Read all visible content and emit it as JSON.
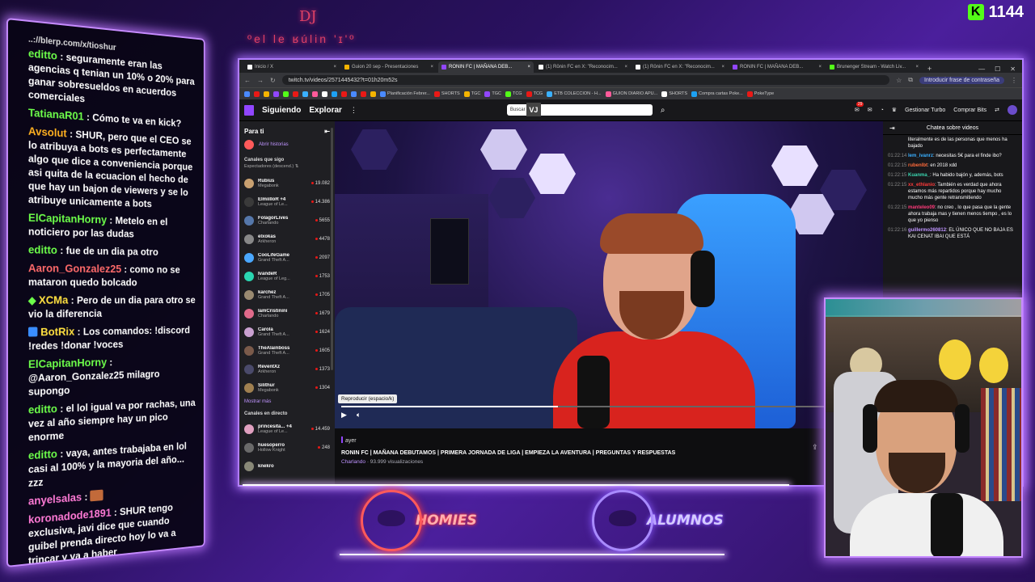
{
  "overlay": {
    "scribble_top": "DJ",
    "scribble_bottom": "ºel le ʁúlin 'ɪ'º",
    "viewer_count": "1144",
    "viewer_platform_icon": "kick-icon",
    "logo_left": "HOMIES",
    "logo_right": "ALUMNOS"
  },
  "stream_chat": [
    {
      "user": "editto",
      "color": "#6dff4a",
      "text": "seguramente eran las agencias q tenian un 10% o 20% para ganar sobresueldos en acuerdos comerciales",
      "prefix": "..://blerp.com/x/tioshur"
    },
    {
      "user": "TatianaR01",
      "color": "#6dff4a",
      "text": "Cómo te va en kick?"
    },
    {
      "user": "Avsolut",
      "color": "#ffb020",
      "text": "SHUR, pero que el CEO se lo atribuya a bots es perfectamente algo que dice a conveniencia porque asi quita de la ecuacion el hecho de que hay un bajon de viewers y se lo atribuye unicamente a bots"
    },
    {
      "user": "ElCapitanHorny",
      "color": "#6dff4a",
      "text": "Metelo en el noticiero por las dudas"
    },
    {
      "user": "editto",
      "color": "#6dff4a",
      "text": "fue de un dia pa otro"
    },
    {
      "user": "Aaron_Gonzalez25",
      "color": "#ff6a6a",
      "text": "como no se mataron quedo bolcado"
    },
    {
      "user": "XCMa",
      "color": "#ffe040",
      "text": "Pero de un dia para otro se vio la diferencia"
    },
    {
      "user": "BotRix",
      "color": "#ffe040",
      "text": "Los comandos: !discord !redes !donar !voces"
    },
    {
      "user": "ElCapitanHorny",
      "color": "#6dff4a",
      "text": "@Aaron_Gonzalez25 milagro supongo"
    },
    {
      "user": "editto",
      "color": "#6dff4a",
      "text": "el lol igual va por rachas, una vez al año siempre hay un pico enorme"
    },
    {
      "user": "editto",
      "color": "#6dff4a",
      "text": "vaya, antes trabajaba en lol casi al 100% y la mayoria del año... zzz"
    },
    {
      "user": "anyelsalas",
      "color": "#ff7ad6",
      "text": ""
    },
    {
      "user": "koronadode1891",
      "color": "#ff7ad6",
      "text": "SHUR tengo exclusiva, javi dice que cuando guibel prenda directo hoy lo va a trincar y va a haber debateeeeeeeeeeeeee"
    }
  ],
  "browser": {
    "tabs": [
      {
        "label": "Inicio / X",
        "color": "#fff"
      },
      {
        "label": "Guion 20 sep - Presentaciones",
        "color": "#f4b400"
      },
      {
        "label": "RONIN FC | MAÑANA DEB...",
        "color": "#9146ff"
      },
      {
        "label": "(1) Rōnin FC en X: \"Reconocim...",
        "color": "#fff"
      },
      {
        "label": "(1) Rōnin FC en X: \"Reconocim...",
        "color": "#fff"
      },
      {
        "label": "RONIN FC | MAÑANA DEB...",
        "color": "#9146ff"
      },
      {
        "label": "Brunenger Stream - Watch Liv...",
        "color": "#53fc18"
      }
    ],
    "new_tab": "+",
    "url": "twitch.tv/videos/2571445432?t=01h20m52s",
    "password_prompt": "Introducir frase de contraseña",
    "bookmarks": [
      "Planificación Febrer...",
      "SHORTS",
      "TGC",
      "TGC",
      "TCG",
      "TCG",
      "ETB COLECCION - H...",
      "GUION DIARIO APU...",
      "SHORTS",
      "Compra cartas Poke...",
      "PokeType"
    ]
  },
  "twitch": {
    "nav_following": "Siguiendo",
    "nav_browse": "Explorar",
    "search_placeholder": "Buscar",
    "search_overlay": "VJ",
    "notif_count": "29",
    "turbo": "Gestionar Turbo",
    "bits": "Comprar Bits",
    "sidebar_title": "Para ti",
    "history": "Abrir historias",
    "followed_header": "Canales que sigo",
    "followed_sub": "Espectadores (descend.)",
    "channels": [
      {
        "name": "Rubius",
        "game": "Megabonk",
        "viewers": "19.082",
        "color": "#c8a070"
      },
      {
        "name": "ElmiilloR +4",
        "game": "League of Le...",
        "viewers": "14.386",
        "color": "#3a3a3a"
      },
      {
        "name": "FolagorLives",
        "game": "Charlando",
        "viewers": "5655",
        "color": "#5577aa"
      },
      {
        "name": "elxokas",
        "game": "Arkheron",
        "viewers": "4478",
        "color": "#888"
      },
      {
        "name": "CooLifeGame",
        "game": "Grand Theft A...",
        "viewers": "2097",
        "color": "#4aa8ff"
      },
      {
        "name": "IvandeR",
        "game": "League of Leg...",
        "viewers": "1753",
        "color": "#2ad6b0"
      },
      {
        "name": "karchez",
        "game": "Grand Theft A...",
        "viewers": "1705",
        "color": "#9a8a70"
      },
      {
        "name": "IamCristinini",
        "game": "Charlando",
        "viewers": "1679",
        "color": "#e06a8a"
      },
      {
        "name": "Carola",
        "game": "Grand Theft A...",
        "viewers": "1624",
        "color": "#c9a0d0"
      },
      {
        "name": "TheAlainboss",
        "game": "Grand Theft A...",
        "viewers": "1605",
        "color": "#7a5a4a"
      },
      {
        "name": "ReventXz",
        "game": "Arkheron",
        "viewers": "1373",
        "color": "#4a4a6a"
      },
      {
        "name": "Silithur",
        "game": "Megabonk",
        "viewers": "1304",
        "color": "#a08050"
      }
    ],
    "show_more": "Mostrar más",
    "live_header": "Canales en directo",
    "live_channels": [
      {
        "name": "princesita... +4",
        "game": "League of Le...",
        "viewers": "14.459",
        "color": "#e0a0c0"
      },
      {
        "name": "huesoperro",
        "game": "Hollow Knight",
        "viewers": "248",
        "color": "#6a6a6a"
      },
      {
        "name": "knekro",
        "game": "",
        "viewers": "",
        "color": "#887"
      }
    ],
    "tooltip": "Reproducir (espacio/k)",
    "video_date": "ayer",
    "video_title": "RONIN FC | MAÑANA DEBUTAMOS | PRIMERA JORNADA DE LIGA | EMPIEZA LA AVENTURA | PREGUNTAS Y RESPUESTAS",
    "video_category": "Charlando",
    "video_views": "· 93.999 visualizaciones",
    "video_progress": 0.4,
    "chat_title": "Chatea sobre videos",
    "video_chat": [
      {
        "time": "",
        "user": "",
        "color": "#fff",
        "text": "literalmente es de las personas que menos ha bajado"
      },
      {
        "time": "01:22:14",
        "user": "lem_ivanrz",
        "color": "#3ab0ff",
        "text": "necesitas 5€ para el finde ibo?"
      },
      {
        "time": "01:22:15",
        "user": "rubenlbt",
        "color": "#ff6a3a",
        "text": "en 2018 xdd"
      },
      {
        "time": "01:22:15",
        "user": "Kuanma_",
        "color": "#3ad6b0",
        "text": "Ha habido bajón y, además, bots"
      },
      {
        "time": "01:22:15",
        "user": "xx_ethlanio",
        "color": "#ff3a3a",
        "text": "También es verdad que ahora estamos más repartidos porque hay mucho mucho más gente retransmitiendo"
      },
      {
        "time": "01:22:15",
        "user": "manteleo09",
        "color": "#ff3a7a",
        "text": "no creo , lo que pasa que la gente ahora trabaja mas y tienen menos tiempo , es lo que yo pienso"
      },
      {
        "time": "01:22:16",
        "user": "guillermo260812",
        "color": "#bf94ff",
        "text": "EL ÚNICO QUE NO BAJA ES KAI CENAT IBAI QUE ESTÁ"
      }
    ]
  }
}
